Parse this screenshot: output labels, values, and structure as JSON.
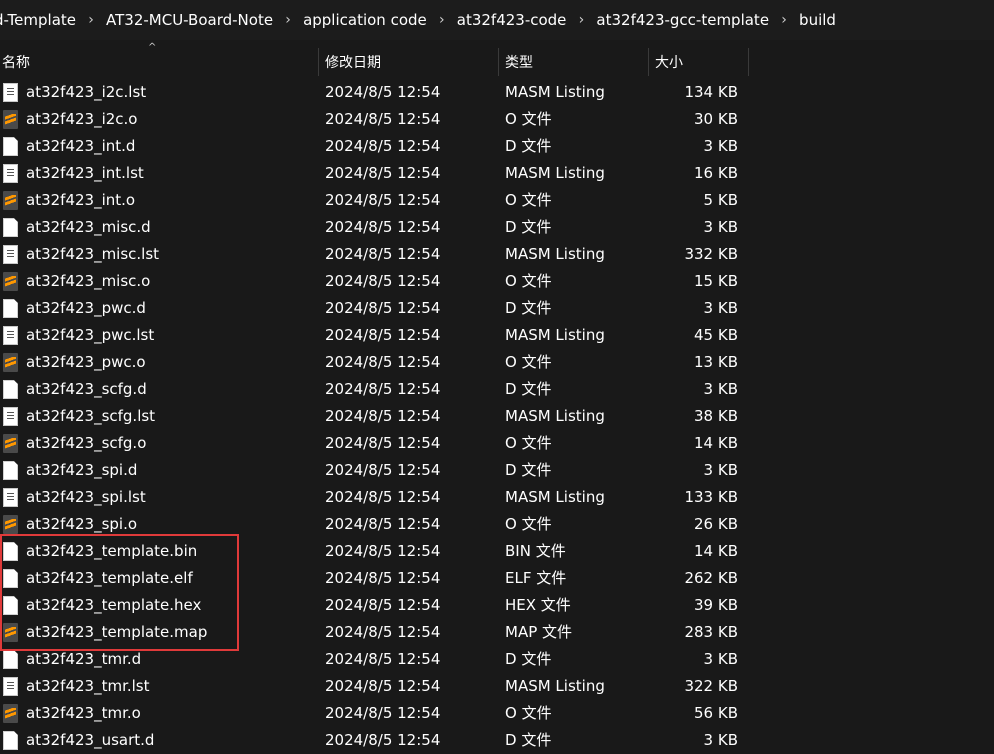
{
  "breadcrumb": [
    "d-Template",
    "AT32-MCU-Board-Note",
    "application code",
    "at32f423-code",
    "at32f423-gcc-template",
    "build"
  ],
  "columns": {
    "name": "名称",
    "date": "修改日期",
    "type": "类型",
    "size": "大小"
  },
  "files": [
    {
      "name": "at32f423_i2c.lst",
      "date": "2024/8/5 12:54",
      "type": "MASM Listing",
      "size": "134 KB",
      "icon": "list"
    },
    {
      "name": "at32f423_i2c.o",
      "date": "2024/8/5 12:54",
      "type": "O 文件",
      "size": "30 KB",
      "icon": "sublime"
    },
    {
      "name": "at32f423_int.d",
      "date": "2024/8/5 12:54",
      "type": "D 文件",
      "size": "3 KB",
      "icon": "file"
    },
    {
      "name": "at32f423_int.lst",
      "date": "2024/8/5 12:54",
      "type": "MASM Listing",
      "size": "16 KB",
      "icon": "list"
    },
    {
      "name": "at32f423_int.o",
      "date": "2024/8/5 12:54",
      "type": "O 文件",
      "size": "5 KB",
      "icon": "sublime"
    },
    {
      "name": "at32f423_misc.d",
      "date": "2024/8/5 12:54",
      "type": "D 文件",
      "size": "3 KB",
      "icon": "file"
    },
    {
      "name": "at32f423_misc.lst",
      "date": "2024/8/5 12:54",
      "type": "MASM Listing",
      "size": "332 KB",
      "icon": "list"
    },
    {
      "name": "at32f423_misc.o",
      "date": "2024/8/5 12:54",
      "type": "O 文件",
      "size": "15 KB",
      "icon": "sublime"
    },
    {
      "name": "at32f423_pwc.d",
      "date": "2024/8/5 12:54",
      "type": "D 文件",
      "size": "3 KB",
      "icon": "file"
    },
    {
      "name": "at32f423_pwc.lst",
      "date": "2024/8/5 12:54",
      "type": "MASM Listing",
      "size": "45 KB",
      "icon": "list"
    },
    {
      "name": "at32f423_pwc.o",
      "date": "2024/8/5 12:54",
      "type": "O 文件",
      "size": "13 KB",
      "icon": "sublime"
    },
    {
      "name": "at32f423_scfg.d",
      "date": "2024/8/5 12:54",
      "type": "D 文件",
      "size": "3 KB",
      "icon": "file"
    },
    {
      "name": "at32f423_scfg.lst",
      "date": "2024/8/5 12:54",
      "type": "MASM Listing",
      "size": "38 KB",
      "icon": "list"
    },
    {
      "name": "at32f423_scfg.o",
      "date": "2024/8/5 12:54",
      "type": "O 文件",
      "size": "14 KB",
      "icon": "sublime"
    },
    {
      "name": "at32f423_spi.d",
      "date": "2024/8/5 12:54",
      "type": "D 文件",
      "size": "3 KB",
      "icon": "file"
    },
    {
      "name": "at32f423_spi.lst",
      "date": "2024/8/5 12:54",
      "type": "MASM Listing",
      "size": "133 KB",
      "icon": "list"
    },
    {
      "name": "at32f423_spi.o",
      "date": "2024/8/5 12:54",
      "type": "O 文件",
      "size": "26 KB",
      "icon": "sublime"
    },
    {
      "name": "at32f423_template.bin",
      "date": "2024/8/5 12:54",
      "type": "BIN 文件",
      "size": "14 KB",
      "icon": "file"
    },
    {
      "name": "at32f423_template.elf",
      "date": "2024/8/5 12:54",
      "type": "ELF 文件",
      "size": "262 KB",
      "icon": "file"
    },
    {
      "name": "at32f423_template.hex",
      "date": "2024/8/5 12:54",
      "type": "HEX 文件",
      "size": "39 KB",
      "icon": "file"
    },
    {
      "name": "at32f423_template.map",
      "date": "2024/8/5 12:54",
      "type": "MAP 文件",
      "size": "283 KB",
      "icon": "sublime"
    },
    {
      "name": "at32f423_tmr.d",
      "date": "2024/8/5 12:54",
      "type": "D 文件",
      "size": "3 KB",
      "icon": "file"
    },
    {
      "name": "at32f423_tmr.lst",
      "date": "2024/8/5 12:54",
      "type": "MASM Listing",
      "size": "322 KB",
      "icon": "list"
    },
    {
      "name": "at32f423_tmr.o",
      "date": "2024/8/5 12:54",
      "type": "O 文件",
      "size": "56 KB",
      "icon": "sublime"
    },
    {
      "name": "at32f423_usart.d",
      "date": "2024/8/5 12:54",
      "type": "D 文件",
      "size": "3 KB",
      "icon": "file"
    }
  ],
  "colors": {
    "background": "#191919",
    "highlight": "#e03a3a",
    "accent_orange": "#ff9800"
  }
}
